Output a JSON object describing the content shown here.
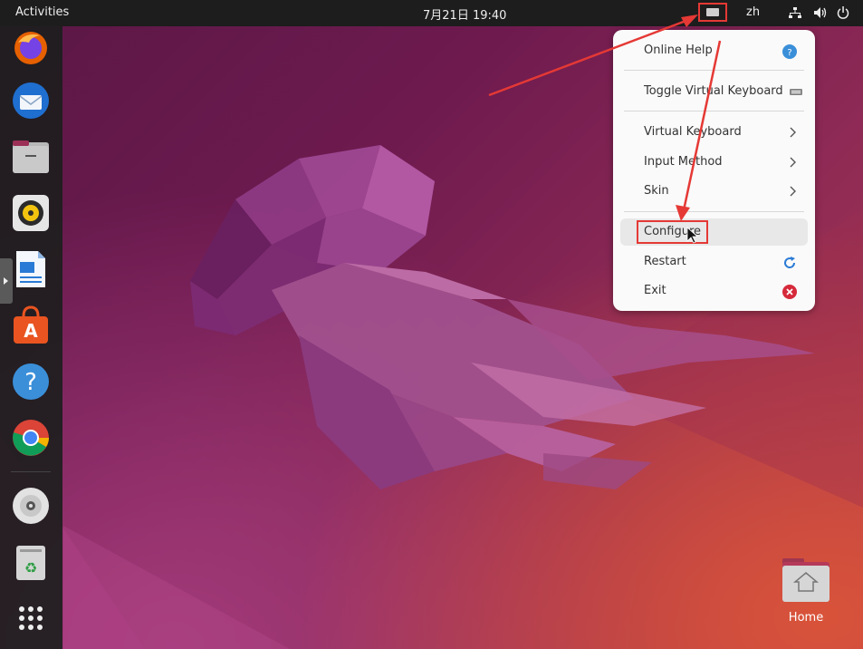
{
  "topbar": {
    "activities": "Activities",
    "clock": "7月21日  19:40",
    "language": "zh",
    "keyboard_indicator_icon": "keyboard-icon",
    "network_icon": "network-icon",
    "volume_icon": "volume-icon",
    "power_icon": "power-icon"
  },
  "dock": {
    "apps": [
      {
        "name": "firefox"
      },
      {
        "name": "thunderbird"
      },
      {
        "name": "files"
      },
      {
        "name": "rhythmbox"
      },
      {
        "name": "libreoffice-writer"
      },
      {
        "name": "ubuntu-software"
      },
      {
        "name": "help"
      },
      {
        "name": "chrome"
      },
      {
        "name": "dvd-drive"
      },
      {
        "name": "trash"
      },
      {
        "name": "show-applications"
      }
    ]
  },
  "menu": {
    "online_help": "Online Help",
    "toggle_virtual_keyboard": "Toggle Virtual Keyboard",
    "virtual_keyboard": "Virtual Keyboard",
    "input_method": "Input Method",
    "skin": "Skin",
    "configure": "Configure",
    "restart": "Restart",
    "exit": "Exit"
  },
  "desktop": {
    "home_label": "Home"
  },
  "colors": {
    "annotation_red": "#e53935",
    "help_blue": "#3b8fd9",
    "exit_red": "#d62a3b",
    "topbar": "#1d1d1d"
  }
}
